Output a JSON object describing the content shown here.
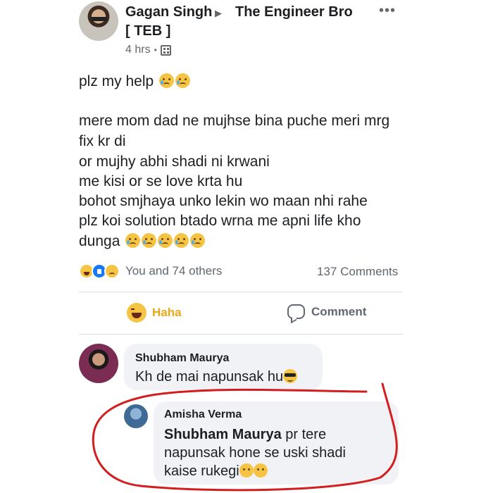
{
  "post": {
    "author": "Gagan Singh",
    "group_line1": "The Engineer Bro",
    "group_line2": "[ TEB ]",
    "time": "4 hrs",
    "body_lines": [
      "plz my help",
      "mere mom dad ne mujhse bina puche meri mrg",
      "fix kr di",
      "or mujhy abhi shadi ni krwani",
      "me kisi or se love krta hu",
      "bohot smjhaya unko lekin wo maan nhi rahe",
      "plz koi solution btado wrna me apni life kho",
      "dunga"
    ],
    "reactions_text": "You and 74 others",
    "comments_count": "137 Comments"
  },
  "actions": {
    "haha_label": "Haha",
    "comment_label": "Comment"
  },
  "comments": [
    {
      "author": "Shubham Maurya",
      "text": "Kh de mai napunsak hu"
    },
    {
      "author": "Amisha Verma",
      "mention": "Shubham Maurya",
      "text_line1_rest": " pr tere",
      "text_line2": "napunsak hone se uski shadi",
      "text_line3": "kaise rukegi"
    }
  ],
  "colors": {
    "accent_haha": "#e6a817",
    "annotation_red": "#d21e1e",
    "bubble_bg": "#f0f2f5",
    "secondary_text": "#65676b"
  },
  "icons": [
    "more-options-icon",
    "group-icon",
    "crying-face-emoji",
    "haha-reaction-icon",
    "like-reaction-icon",
    "sad-reaction-icon",
    "comment-icon",
    "sunglasses-emoji",
    "neutral-face-emoji"
  ]
}
